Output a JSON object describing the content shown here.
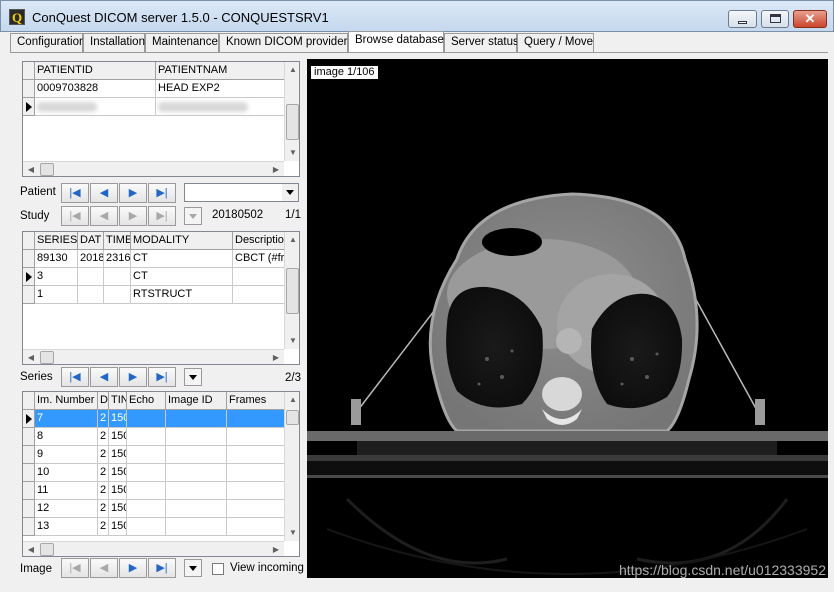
{
  "window": {
    "title": "ConQuest DICOM server 1.5.0 - CONQUESTSRV1",
    "app_icon_letter": "Q",
    "minimize_icon": "minimize-icon",
    "maximize_icon": "maximize-icon",
    "close_glyph": "✕"
  },
  "tabs": [
    {
      "label": "Configuration"
    },
    {
      "label": "Installation"
    },
    {
      "label": "Maintenance"
    },
    {
      "label": "Known DICOM providers"
    },
    {
      "label": "Browse database",
      "active": true
    },
    {
      "label": "Server status"
    },
    {
      "label": "Query / Move"
    }
  ],
  "patients": {
    "columns": [
      "PATIENTID",
      "PATIENTNAM"
    ],
    "rows": [
      [
        "0009703828",
        "HEAD EXP2"
      ]
    ],
    "redacted_row_present": true
  },
  "patient_nav": {
    "label": "Patient",
    "combo_value": ""
  },
  "study_nav": {
    "label": "Study",
    "date": "20180502",
    "position": "1/1"
  },
  "series": {
    "columns": [
      "SERIES",
      "DAT",
      "TIME",
      "MODALITY",
      "Descriptio"
    ],
    "rows": [
      [
        "89130",
        "2018",
        "2316",
        "CT",
        "CBCT (#fr"
      ],
      [
        "3",
        "",
        "",
        "CT",
        ""
      ],
      [
        "1",
        "",
        "",
        "RTSTRUCT",
        ""
      ]
    ]
  },
  "series_nav": {
    "label": "Series",
    "position": "2/3"
  },
  "images": {
    "columns": [
      "Im. Number",
      "D",
      "TIN",
      "Echo",
      "Image ID",
      "Frames"
    ],
    "rows": [
      [
        "7",
        "2",
        "150",
        "",
        "",
        ""
      ],
      [
        "8",
        "2",
        "150",
        "",
        "",
        ""
      ],
      [
        "9",
        "2",
        "150",
        "",
        "",
        ""
      ],
      [
        "10",
        "2",
        "150",
        "",
        "",
        ""
      ],
      [
        "11",
        "2",
        "150",
        "",
        "",
        ""
      ],
      [
        "12",
        "2",
        "150",
        "",
        "",
        ""
      ],
      [
        "13",
        "2",
        "150",
        "",
        "",
        ""
      ]
    ]
  },
  "image_nav": {
    "label": "Image",
    "view_incoming_label": "View incoming",
    "view_incoming_checked": false
  },
  "viewer": {
    "caption": "image 1/106",
    "watermark": "https://blog.csdn.net/u012333952"
  },
  "nav_glyphs": {
    "first": "|◀",
    "prev": "◀",
    "next": "▶",
    "last": "▶|"
  }
}
